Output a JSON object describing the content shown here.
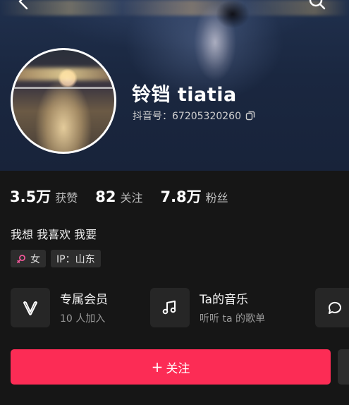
{
  "profile": {
    "name": "铃铛 tiatia",
    "douyin_id": "抖音号：67205320260"
  },
  "stats": [
    {
      "value": "3.5万",
      "label": "获赞"
    },
    {
      "value": "82",
      "label": "关注"
    },
    {
      "value": "7.8万",
      "label": "粉丝"
    }
  ],
  "bio": "我想 我喜欢 我要",
  "tags": {
    "gender": "女",
    "ip": "IP：山东"
  },
  "features": [
    {
      "title": "专属会员",
      "subtitle": "10 人加入",
      "icon": "heart-v-icon"
    },
    {
      "title": "Ta的音乐",
      "subtitle": "听听 ta 的歌单",
      "icon": "music-note-icon"
    }
  ],
  "actions": {
    "follow_plus": "+",
    "follow_label": "关注"
  },
  "colors": {
    "accent": "#fc2c55",
    "background": "#161616",
    "card": "#262626"
  }
}
